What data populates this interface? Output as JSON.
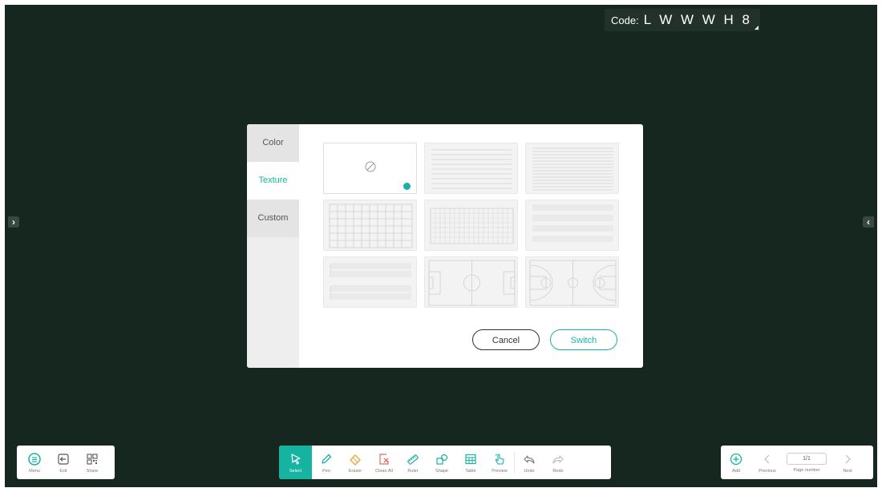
{
  "code": {
    "label": "Code:",
    "value": "L W W W H 8"
  },
  "edge": {
    "left": "›",
    "right": "‹"
  },
  "dialog": {
    "tabs": [
      {
        "label": "Color",
        "active": false
      },
      {
        "label": "Texture",
        "active": true
      },
      {
        "label": "Custom",
        "active": false
      }
    ],
    "textures": [
      {
        "name": "none",
        "selected": true
      },
      {
        "name": "lined-wide"
      },
      {
        "name": "lined-narrow"
      },
      {
        "name": "grid-large"
      },
      {
        "name": "grid-small"
      },
      {
        "name": "music-staff"
      },
      {
        "name": "music-staff-double"
      },
      {
        "name": "football-field"
      },
      {
        "name": "basketball-court"
      }
    ],
    "cancel_label": "Cancel",
    "switch_label": "Switch"
  },
  "toolbar_left": [
    {
      "label": "Menu",
      "icon": "menu-icon"
    },
    {
      "label": "Exit",
      "icon": "exit-icon"
    },
    {
      "label": "Share",
      "icon": "qr-icon"
    }
  ],
  "toolbar_center": [
    {
      "label": "Select",
      "icon": "cursor-icon",
      "active": true
    },
    {
      "label": "Pen",
      "icon": "pen-icon"
    },
    {
      "label": "Eraser",
      "icon": "eraser-icon"
    },
    {
      "label": "Clean All",
      "icon": "clean-all-icon"
    },
    {
      "label": "Ruler",
      "icon": "ruler-icon"
    },
    {
      "label": "Shape",
      "icon": "shape-icon"
    },
    {
      "label": "Table",
      "icon": "table-icon"
    },
    {
      "label": "Preview",
      "icon": "hand-icon"
    },
    {
      "label": "Undo",
      "icon": "undo-icon"
    },
    {
      "label": "Redo",
      "icon": "redo-icon"
    }
  ],
  "toolbar_right": {
    "add_label": "Add",
    "previous_label": "Previous",
    "page_value": "1/1",
    "page_label": "Page number",
    "next_label": "Next"
  },
  "colors": {
    "accent": "#16b3a0",
    "board": "#15271e",
    "clean": "#e46b5b",
    "eraser": "#f0a43c"
  }
}
